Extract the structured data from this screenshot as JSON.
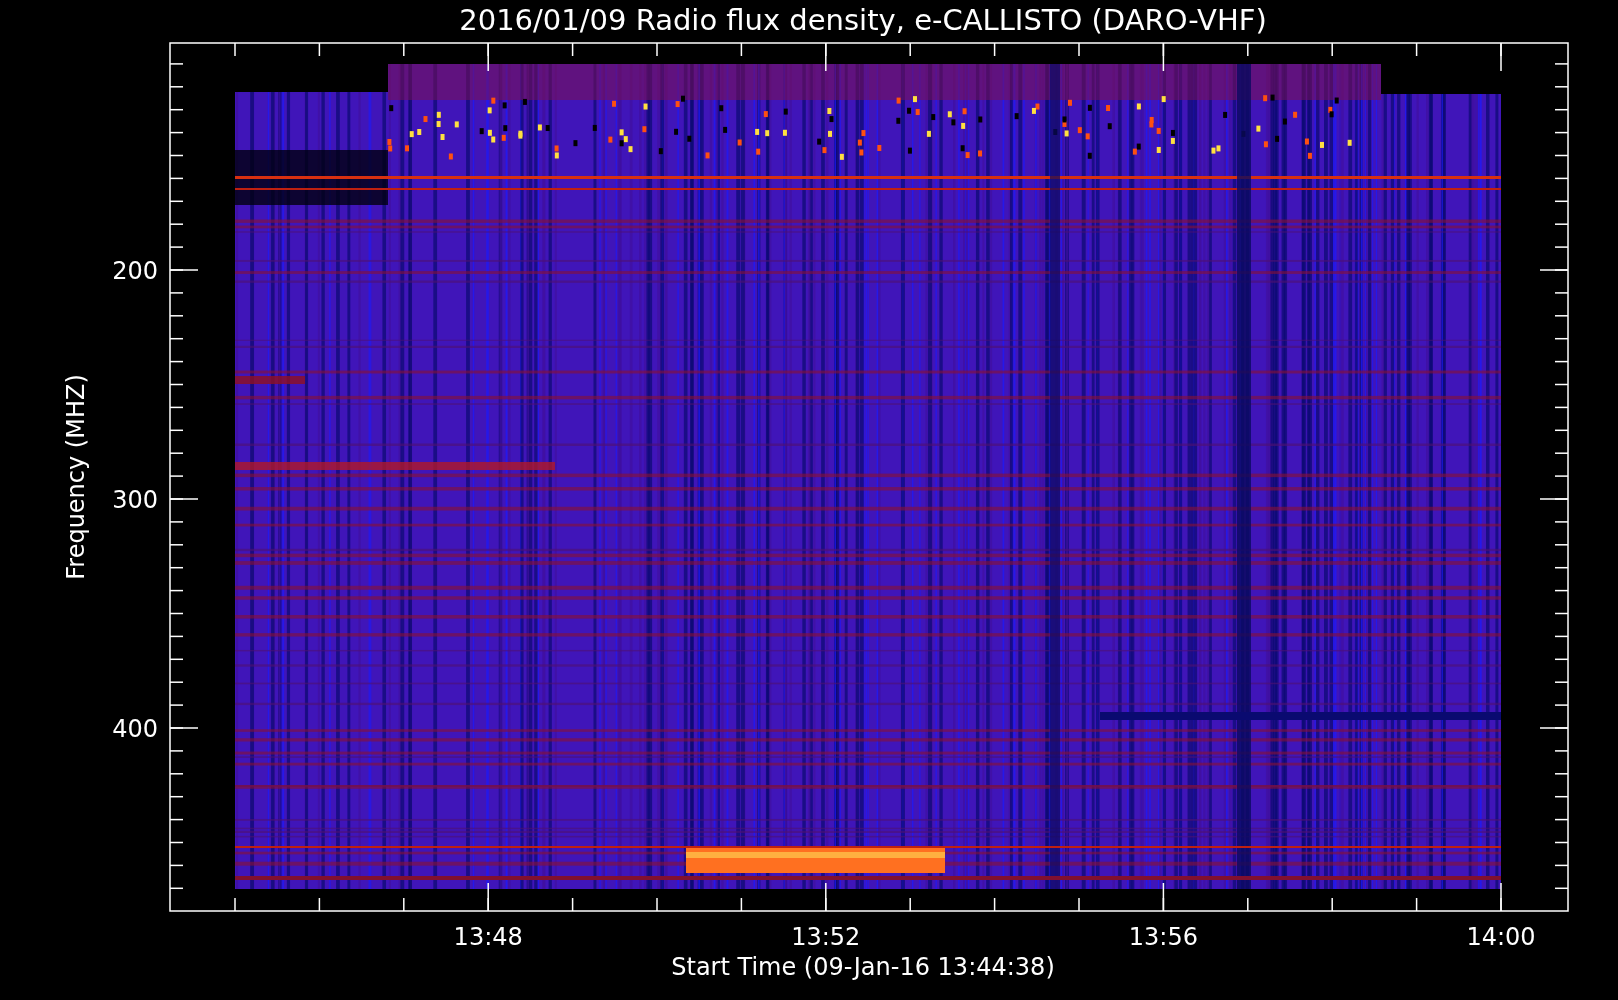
{
  "title": "2016/01/09  Radio flux density, e-CALLISTO (DARO-VHF)",
  "y_axis": {
    "label": "Frequency (MHZ)",
    "ticks": [
      "200",
      "300",
      "400"
    ]
  },
  "x_axis": {
    "label": "Start Time (09-Jan-16 13:44:38)",
    "ticks": [
      "13:48",
      "13:52",
      "13:56",
      "14:00"
    ]
  }
}
